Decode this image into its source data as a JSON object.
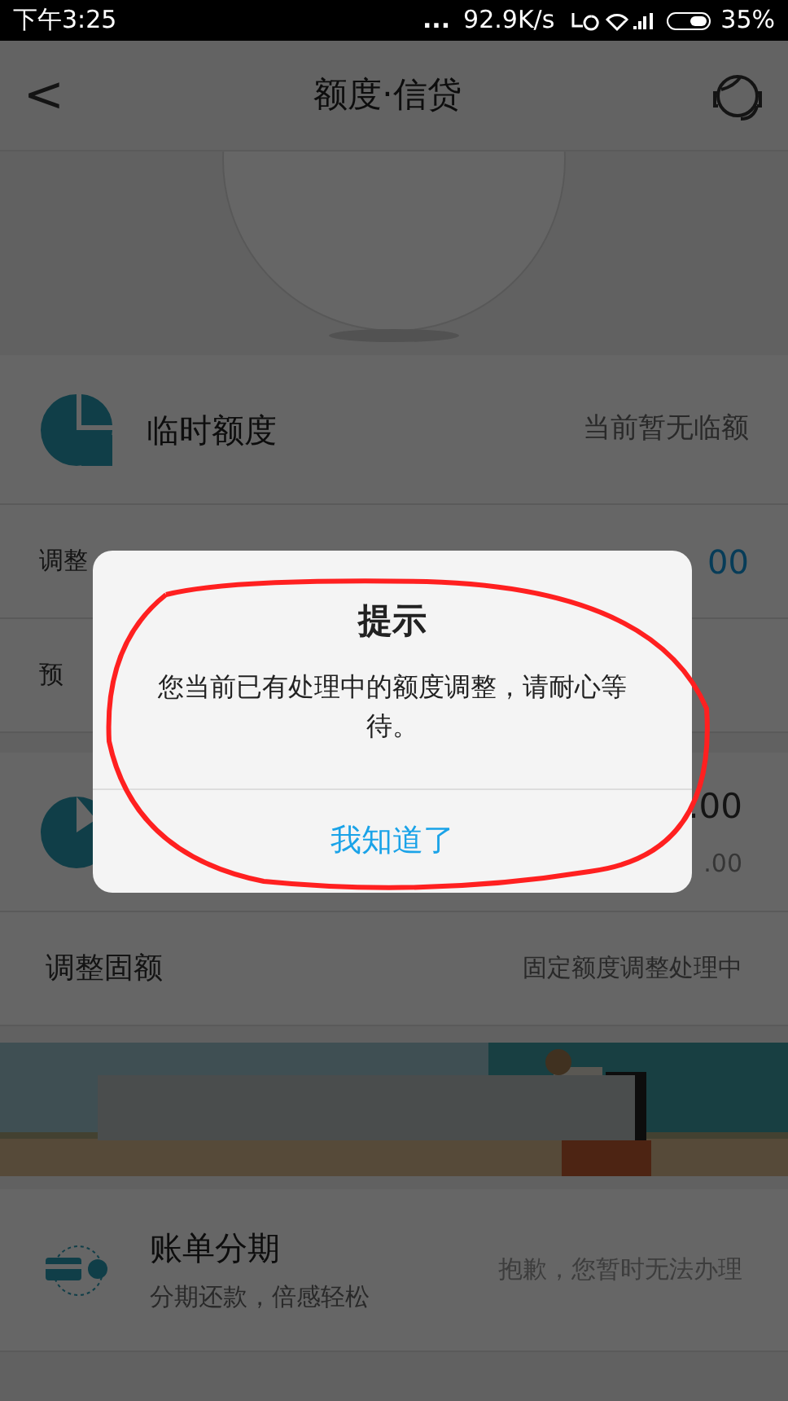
{
  "status_bar": {
    "time": "下午3:25",
    "dots": "...",
    "speed": "92.9K/s",
    "battery": "35%"
  },
  "nav": {
    "back": "<",
    "title": "额度·信贷"
  },
  "temp_quota": {
    "title": "临时额度",
    "status": "当前暂无临额"
  },
  "temp_rows": [
    {
      "label": "调整",
      "value": "00"
    },
    {
      "label": "预"
    }
  ],
  "fixed_quota": {
    "value": ".00",
    "sub": ".00"
  },
  "fixed_rows": [
    {
      "label": "调整固额",
      "value": "固定额度调整处理中"
    }
  ],
  "installment": {
    "title": "账单分期",
    "subtitle": "分期还款，倍感轻松",
    "status": "抱歉，您暂时无法办理"
  },
  "dialog": {
    "title": "提示",
    "message": "您当前已有处理中的额度调整，请耐心等待。",
    "button": "我知道了"
  }
}
